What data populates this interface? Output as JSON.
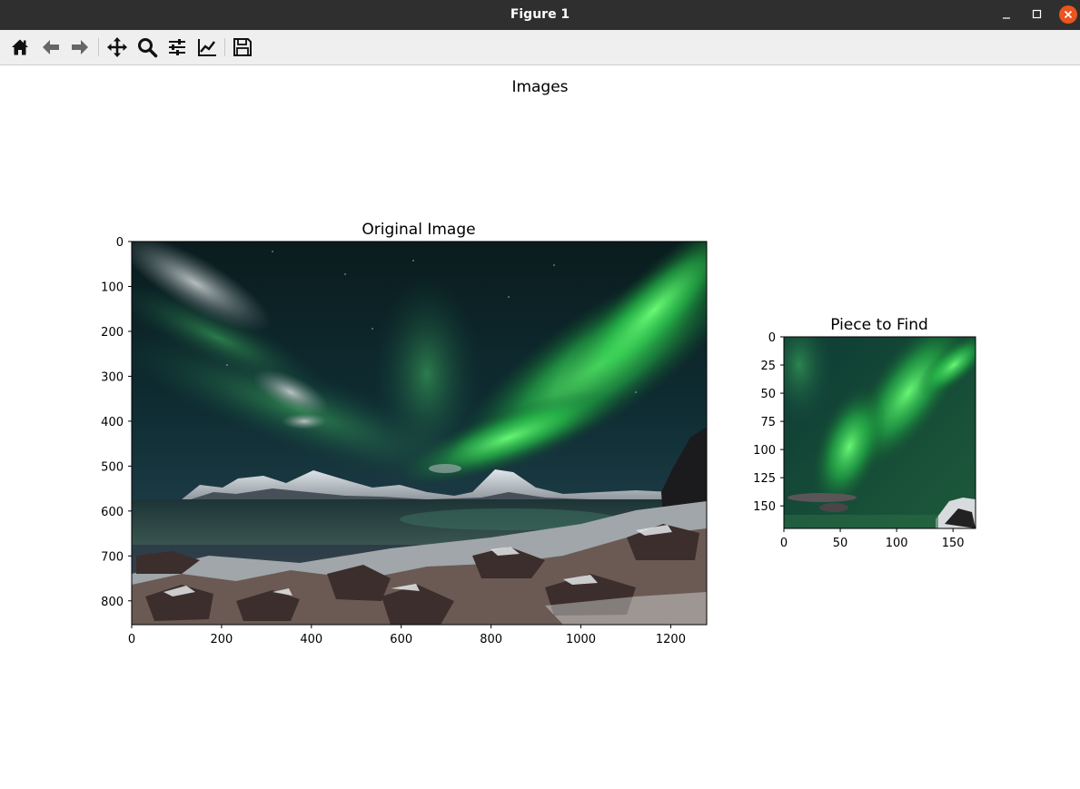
{
  "window": {
    "title": "Figure 1"
  },
  "toolbar": {
    "buttons": [
      {
        "name": "home-icon",
        "label": "Home"
      },
      {
        "name": "back-arrow-icon",
        "label": "Back"
      },
      {
        "name": "forward-arrow-icon",
        "label": "Forward"
      },
      {
        "name": "pan-icon",
        "label": "Pan"
      },
      {
        "name": "zoom-icon",
        "label": "Zoom"
      },
      {
        "name": "configure-subplots-icon",
        "label": "Subplots"
      },
      {
        "name": "edit-axis-icon",
        "label": "Customize"
      },
      {
        "name": "save-icon",
        "label": "Save"
      }
    ]
  },
  "figure": {
    "suptitle": "Images"
  },
  "chart_data": [
    {
      "type": "image",
      "title": "Original Image",
      "image_size": [
        1280,
        853
      ],
      "xlim": [
        0,
        1280
      ],
      "ylim": [
        853,
        0
      ],
      "xticks": [
        0,
        200,
        400,
        600,
        800,
        1000,
        1200
      ],
      "yticks": [
        0,
        100,
        200,
        300,
        400,
        500,
        600,
        700,
        800
      ]
    },
    {
      "type": "image",
      "title": "Piece to Find",
      "image_size": [
        170,
        170
      ],
      "xlim": [
        0,
        170
      ],
      "ylim": [
        170,
        0
      ],
      "xticks": [
        0,
        50,
        100,
        150
      ],
      "yticks": [
        0,
        25,
        50,
        75,
        100,
        125,
        150
      ]
    }
  ]
}
